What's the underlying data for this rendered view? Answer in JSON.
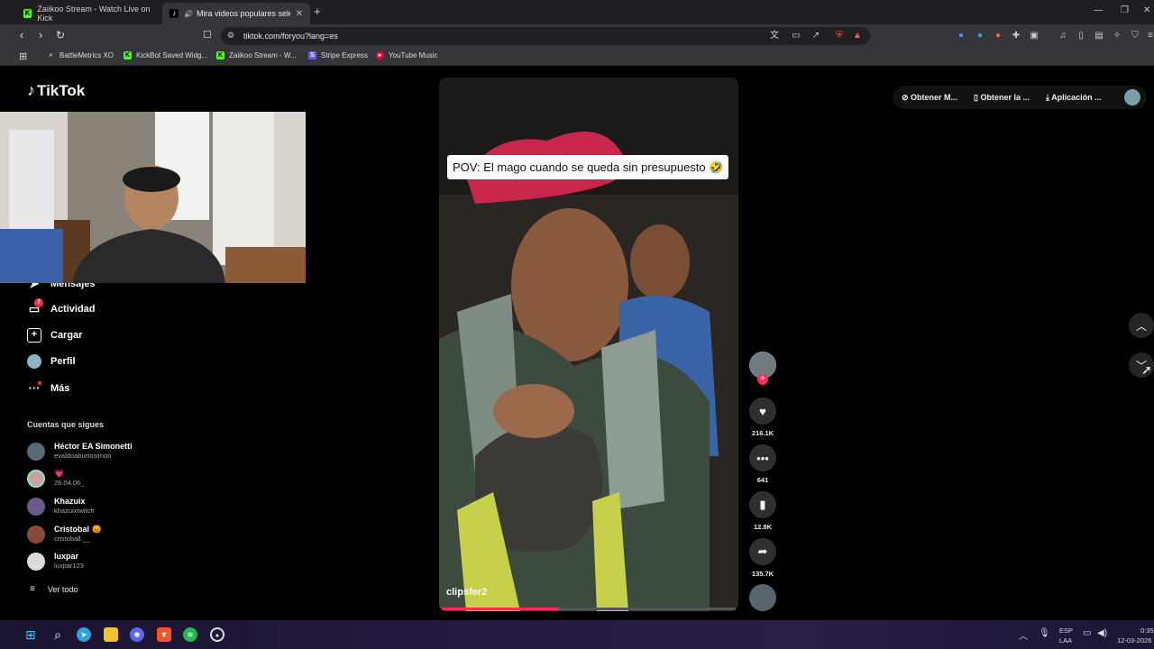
{
  "browser": {
    "tabs": [
      {
        "label": "Zaiikoo Stream - Watch Live on Kick",
        "active": false
      },
      {
        "label": "Mira videos populares selecc",
        "active": true
      }
    ],
    "new_tab_glyph": "+",
    "url": "tiktok.com/foryou?lang=es",
    "bookmarks": [
      {
        "label": "BattleMetrics XO",
        "icon": "search-icon"
      },
      {
        "label": "KickBot Saved Widg...",
        "icon": "kick-icon"
      },
      {
        "label": "Zaiikoo Stream - W...",
        "icon": "kick-icon"
      },
      {
        "label": "Stripe Express",
        "icon": "stripe-icon"
      },
      {
        "label": "YouTube Music",
        "icon": "youtube-music-icon"
      }
    ],
    "colors": {
      "kick": "#53fc18",
      "stripe": "#635bff",
      "youtube": "#ff0033",
      "brave": "#fb542b"
    }
  },
  "tiktok": {
    "logo": "TikTok",
    "nav": [
      {
        "label": "Mensajes",
        "icon": "paper-plane-icon"
      },
      {
        "label": "Actividad",
        "icon": "inbox-icon",
        "badge": "7"
      },
      {
        "label": "Cargar",
        "icon": "upload-icon"
      },
      {
        "label": "Perfil",
        "icon": "profile-avatar"
      },
      {
        "label": "Más",
        "icon": "more-icon"
      }
    ],
    "following_title": "Cuentas que sigues",
    "following": [
      {
        "name": "Héctor EA Simonetti",
        "username": "evaldoaburtosimon"
      },
      {
        "name": "💗",
        "username": "26.04.06_"
      },
      {
        "name": "Khazuix",
        "username": "khazuixtwitch"
      },
      {
        "name": "Cristobal 😡",
        "username": "cristoball.__"
      },
      {
        "name": "luxpar",
        "username": "luxpar123"
      }
    ],
    "see_all": "Ver todo",
    "top_actions": [
      "Obtener M...",
      "Obtener la ...",
      "Aplicación ..."
    ],
    "video": {
      "caption": "POV: El mago cuando se queda sin presupuesto 🤣",
      "author": "clipsfer2",
      "progress": 0.4
    },
    "actions": {
      "likes": "216.1K",
      "comments": "641",
      "saves": "12.8K",
      "shares": "135.7K"
    },
    "accent": "#fe2c55"
  },
  "taskbar": {
    "lang_top": "ESP",
    "lang_bottom": "LAA",
    "time": "0:35",
    "date": "12-03-2026"
  }
}
